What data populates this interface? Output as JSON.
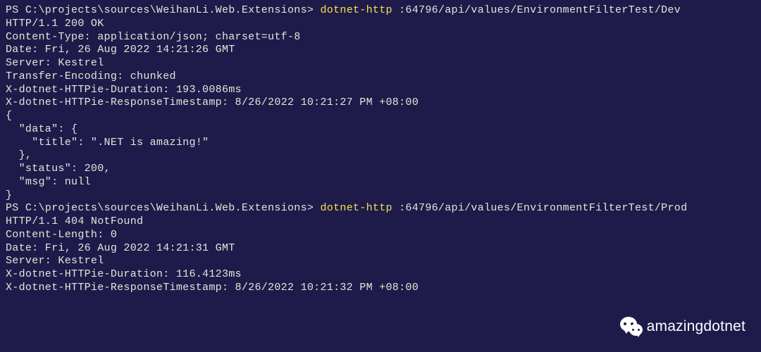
{
  "prompt1": {
    "prefix": "PS C:\\projects\\sources\\WeihanLi.Web.Extensions> ",
    "cmd": "dotnet-http",
    "args": " :64796/api/values/EnvironmentFilterTest/Dev"
  },
  "response1": {
    "status_line": "HTTP/1.1 200 OK",
    "headers": [
      "Content-Type: application/json; charset=utf-8",
      "Date: Fri, 26 Aug 2022 14:21:26 GMT",
      "Server: Kestrel",
      "Transfer-Encoding: chunked",
      "X-dotnet-HTTPie-Duration: 193.0086ms",
      "X-dotnet-HTTPie-ResponseTimestamp: 8/26/2022 10:21:27 PM +08:00"
    ],
    "body_lines": [
      "",
      "{",
      "  \"data\": {",
      "    \"title\": \".NET is amazing!\"",
      "  },",
      "  \"status\": 200,",
      "  \"msg\": null",
      "}"
    ]
  },
  "prompt2": {
    "prefix": "PS C:\\projects\\sources\\WeihanLi.Web.Extensions> ",
    "cmd": "dotnet-http",
    "args": " :64796/api/values/EnvironmentFilterTest/Prod"
  },
  "response2": {
    "status_line": "HTTP/1.1 404 NotFound",
    "headers": [
      "Content-Length: 0",
      "Date: Fri, 26 Aug 2022 14:21:31 GMT",
      "Server: Kestrel",
      "X-dotnet-HTTPie-Duration: 116.4123ms",
      "X-dotnet-HTTPie-ResponseTimestamp: 8/26/2022 10:21:32 PM +08:00"
    ]
  },
  "watermark": {
    "text": "amazingdotnet"
  }
}
